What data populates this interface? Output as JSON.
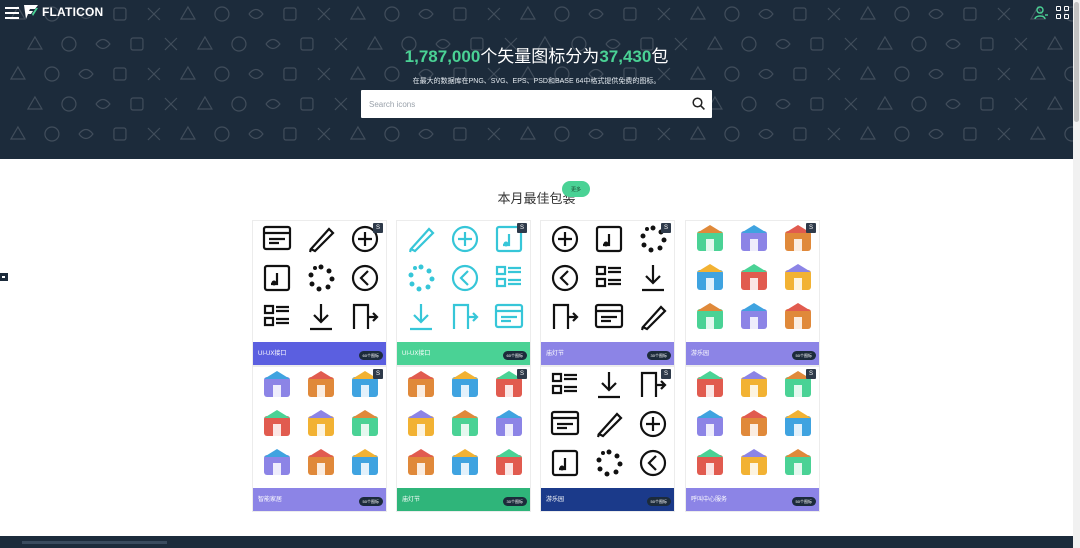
{
  "app": {
    "logo_text": "FLATICON"
  },
  "colors": {
    "hero_bg": "#1c2b3b",
    "accent": "#4ad295"
  },
  "hero": {
    "title_count": "1,787,000",
    "title_mid": "个矢量图标分为",
    "title_packs": "37,430",
    "title_end": "包",
    "subtitle": "在最大的数据库在PNG、SVG、EPS、PSD和BASE 64中格式提供免费的图标。"
  },
  "search": {
    "placeholder": "Search icons"
  },
  "section": {
    "title": "本月最佳包装",
    "pill": "更多"
  },
  "cards": [
    {
      "name": "UI-UX接口",
      "count": "60个图标",
      "footer_color": "#5b5fe0",
      "style": "line",
      "icon_color": "#111111",
      "badge": "S"
    },
    {
      "name": "UI-UX接口",
      "count": "60个图标",
      "footer_color": "#4ad295",
      "style": "line",
      "icon_color": "#36c6d8",
      "badge": "S"
    },
    {
      "name": "庙灯节",
      "count": "30个图标",
      "footer_color": "#8c84e6",
      "style": "line",
      "icon_color": "#111111",
      "badge": "S"
    },
    {
      "name": "游乐园",
      "count": "50个图标",
      "footer_color": "#8c84e6",
      "style": "color",
      "icon_color": "#e15b4f",
      "badge": "S"
    },
    {
      "name": "智能家居",
      "count": "50个图标",
      "footer_color": "#8c84e6",
      "style": "color",
      "icon_color": "#3fa3e0",
      "badge": "S"
    },
    {
      "name": "庙灯节",
      "count": "30个图标",
      "footer_color": "#2fb57a",
      "style": "color",
      "icon_color": "#e0893a",
      "badge": "S"
    },
    {
      "name": "游乐园",
      "count": "50个图标",
      "footer_color": "#1b3a8a",
      "style": "line",
      "icon_color": "#111111",
      "badge": "S"
    },
    {
      "name": "呼叫中心服务",
      "count": "50个图标",
      "footer_color": "#8c84e6",
      "style": "color",
      "icon_color": "#3fa3e0",
      "badge": "S"
    }
  ]
}
